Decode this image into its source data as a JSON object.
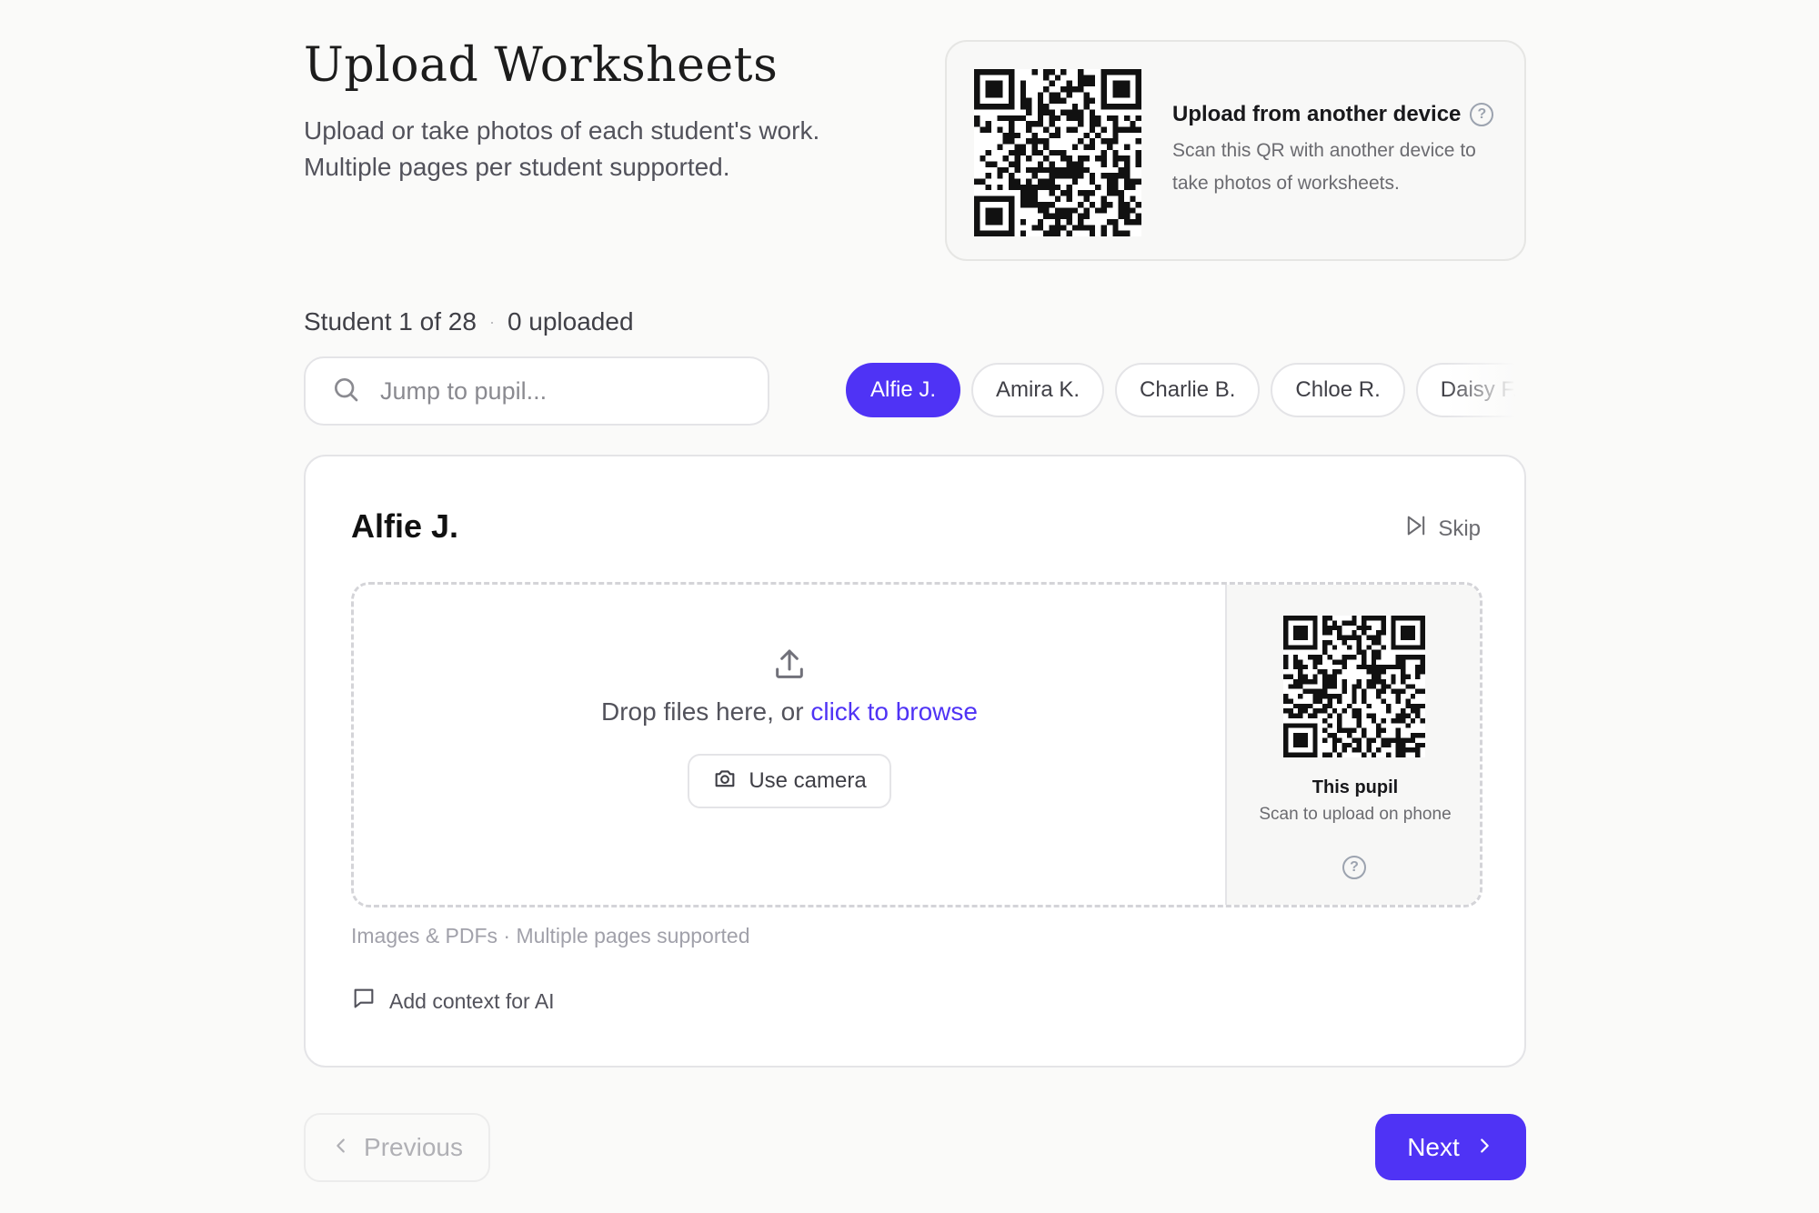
{
  "header": {
    "title": "Upload Worksheets",
    "subtitle": "Upload or take photos of each student's work. Multiple pages per student supported."
  },
  "device_card": {
    "title": "Upload from another device",
    "description": "Scan this QR with another device to take photos of worksheets.",
    "help_glyph": "?"
  },
  "progress": {
    "position": "Student 1 of 28",
    "separator": "·",
    "uploaded": "0 uploaded"
  },
  "search": {
    "placeholder": "Jump to pupil...",
    "value": ""
  },
  "pupils": [
    {
      "label": "Alfie J.",
      "active": true
    },
    {
      "label": "Amira K.",
      "active": false
    },
    {
      "label": "Charlie B.",
      "active": false
    },
    {
      "label": "Chloe R.",
      "active": false
    },
    {
      "label": "Daisy F.",
      "active": false
    }
  ],
  "card": {
    "pupil_name": "Alfie J.",
    "skip_label": "Skip",
    "drop_text": "Drop files here, or ",
    "browse_link": "click to browse",
    "camera_label": "Use camera",
    "side": {
      "title": "This pupil",
      "description": "Scan to upload on phone",
      "help_glyph": "?"
    },
    "file_hint": "Images & PDFs · Multiple pages supported",
    "add_context_label": "Add context for AI"
  },
  "nav": {
    "previous_label": "Previous",
    "next_label": "Next",
    "previous_enabled": false
  },
  "colors": {
    "accent": "#4f33f5",
    "background": "#fafaf9",
    "border": "#e4e4e7"
  },
  "icons": [
    "qr-code-icon",
    "help-icon",
    "search-icon",
    "skip-icon",
    "upload-icon",
    "camera-icon",
    "comment-icon",
    "chevron-left-icon",
    "chevron-right-icon"
  ]
}
